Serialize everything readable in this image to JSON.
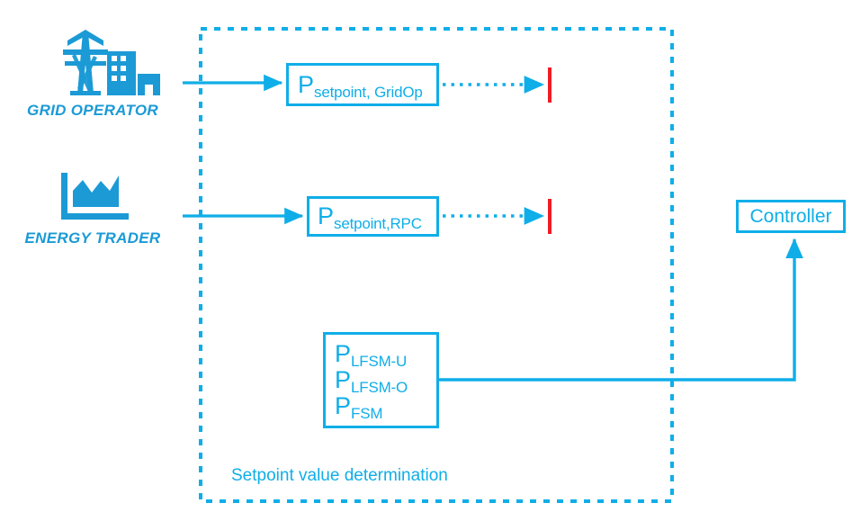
{
  "diagram": {
    "title": "Setpoint value determination",
    "colors": {
      "primary_blue": "#0FAEE8",
      "icon_blue": "#1B9AD6",
      "terminator_red": "#EE1C25",
      "background": "#FFFFFF"
    },
    "actors": [
      {
        "id": "grid-operator",
        "label": "GRID OPERATOR",
        "icon": "transmission-tower-buildings-icon"
      },
      {
        "id": "energy-trader",
        "label": "ENERGY TRADER",
        "icon": "area-chart-icon"
      }
    ],
    "container": {
      "label": "Setpoint value determination",
      "border_style": "dashed"
    },
    "blocks": [
      {
        "id": "setpoint-gridop",
        "symbol": "P",
        "subscript": "setpoint, GridOp"
      },
      {
        "id": "setpoint-rpc",
        "symbol": "P",
        "subscript": "setpoint,RPC"
      },
      {
        "id": "fsm",
        "lines": [
          {
            "symbol": "P",
            "subscript": "LFSM-U"
          },
          {
            "symbol": "P",
            "subscript": "LFSM-O"
          },
          {
            "symbol": "P",
            "subscript": "FSM"
          }
        ]
      },
      {
        "id": "controller",
        "label": "Controller"
      }
    ],
    "connections": [
      {
        "id": "gridop-to-setpoint",
        "style": "solid-arrow"
      },
      {
        "id": "trader-to-setpoint-rpc",
        "style": "solid-arrow"
      },
      {
        "id": "setpoint-gridop-to-terminator",
        "style": "dotted-arrow"
      },
      {
        "id": "setpoint-rpc-to-terminator",
        "style": "dotted-arrow"
      },
      {
        "id": "fsm-to-controller",
        "style": "solid-arrow"
      }
    ],
    "terminators": [
      {
        "id": "terminator-gridop",
        "color": "#EE1C25"
      },
      {
        "id": "terminator-rpc",
        "color": "#EE1C25"
      }
    ]
  }
}
